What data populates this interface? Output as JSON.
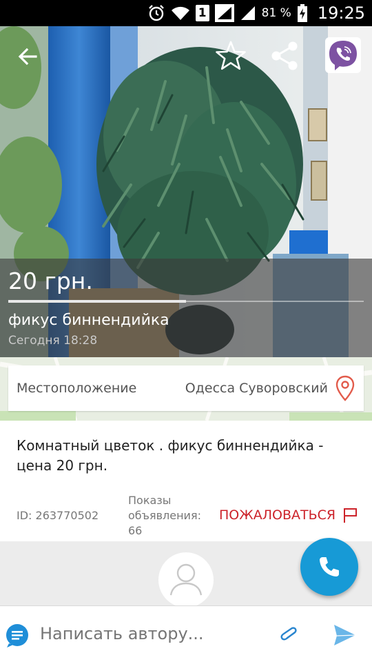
{
  "status_bar": {
    "battery_percent": "81 %",
    "sim_slot": "1",
    "time": "19:25"
  },
  "listing": {
    "price": "20 грн.",
    "title": "фикус биннендийка",
    "date": "Сегодня 18:28",
    "location_label": "Местоположение",
    "location_value": "Одесса Суворовский",
    "description": "Комнатный цветок . фикус биннендийка - цена 20 грн.",
    "id_text": "ID: 263770502",
    "views_text": "Показы объявления: 66",
    "report_label": "ПОЖАЛОВАТЬСЯ",
    "photo_progress": 0.5
  },
  "compose": {
    "placeholder": "Написать автору..."
  },
  "icons": {
    "back": "arrow-left-icon",
    "favorite": "star-icon",
    "share": "share-icon",
    "viber": "viber-icon",
    "pin": "location-pin-icon",
    "report": "flag-icon",
    "call": "phone-icon",
    "avatar": "user-icon",
    "chat": "chat-bubble-icon",
    "attach": "paperclip-icon",
    "send": "send-icon"
  },
  "colors": {
    "accent_blue": "#179ad6",
    "report_red": "#cc2229",
    "viber_purple": "#7d52a2",
    "pin_red": "#e25b4b"
  }
}
